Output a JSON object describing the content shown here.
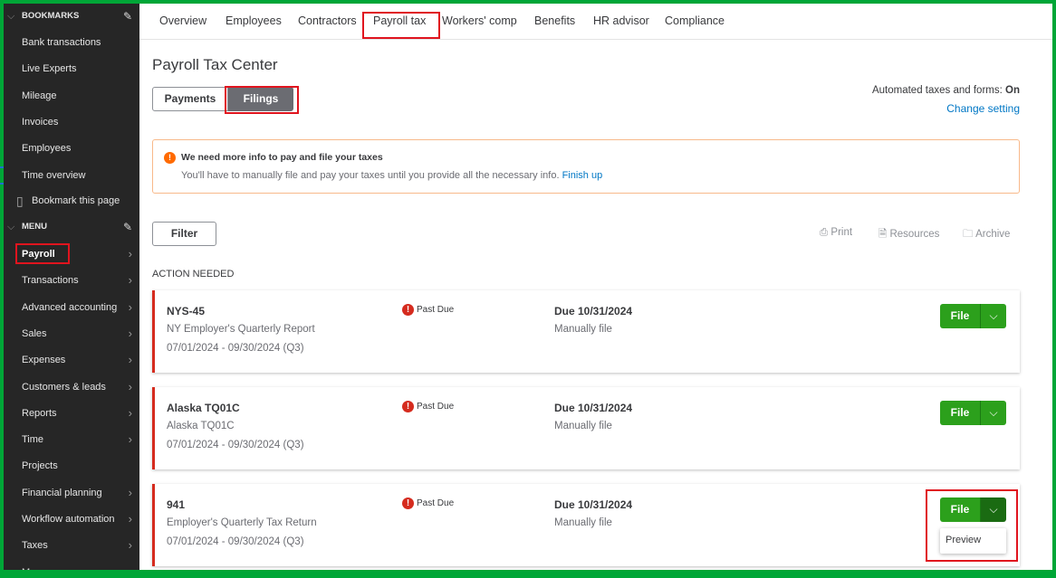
{
  "sidebar": {
    "bookmarks_header": "BOOKMARKS",
    "bookmarks": [
      "Bank transactions",
      "Live Experts",
      "Mileage",
      "Invoices",
      "Employees",
      "Time overview"
    ],
    "bookmark_page": "Bookmark this page",
    "menu_header": "MENU",
    "menu": [
      {
        "label": "Payroll",
        "chevron": true
      },
      {
        "label": "Transactions",
        "chevron": true
      },
      {
        "label": "Advanced accounting",
        "chevron": true
      },
      {
        "label": "Sales",
        "chevron": true
      },
      {
        "label": "Expenses",
        "chevron": true
      },
      {
        "label": "Customers & leads",
        "chevron": true
      },
      {
        "label": "Reports",
        "chevron": true
      },
      {
        "label": "Time",
        "chevron": true
      },
      {
        "label": "Projects",
        "chevron": false
      },
      {
        "label": "Financial planning",
        "chevron": true
      },
      {
        "label": "Workflow automation",
        "chevron": true
      },
      {
        "label": "Taxes",
        "chevron": true
      },
      {
        "label": "My",
        "chevron": false
      }
    ]
  },
  "tabs": [
    "Overview",
    "Employees",
    "Contractors",
    "Payroll tax",
    "Workers' comp",
    "Benefits",
    "HR advisor",
    "Compliance"
  ],
  "page_title": "Payroll Tax Center",
  "segments": {
    "payments": "Payments",
    "filings": "Filings"
  },
  "automation": {
    "label": "Automated taxes and forms:",
    "value": "On",
    "link": "Change setting"
  },
  "alert": {
    "title": "We need more info to pay and file your taxes",
    "body": "You'll have to manually file and pay your taxes until you provide all the necessary info.",
    "link": "Finish up"
  },
  "toolbar": {
    "filter": "Filter",
    "print": "Print",
    "resources": "Resources",
    "archive": "Archive"
  },
  "section_label": "ACTION NEEDED",
  "filings": [
    {
      "code": "NYS-45",
      "name": "NY Employer's Quarterly Report",
      "period": "07/01/2024 - 09/30/2024 (Q3)",
      "status": "Past Due",
      "due": "Due 10/31/2024",
      "method": "Manually file",
      "action": "File"
    },
    {
      "code": "Alaska TQ01C",
      "name": "Alaska TQ01C",
      "period": "07/01/2024 - 09/30/2024 (Q3)",
      "status": "Past Due",
      "due": "Due 10/31/2024",
      "method": "Manually file",
      "action": "File"
    },
    {
      "code": "941",
      "name": "Employer's Quarterly Tax Return",
      "period": "07/01/2024 - 09/30/2024 (Q3)",
      "status": "Past Due",
      "due": "Due 10/31/2024",
      "method": "Manually file",
      "action": "File"
    }
  ],
  "dropdown": {
    "preview": "Preview"
  }
}
